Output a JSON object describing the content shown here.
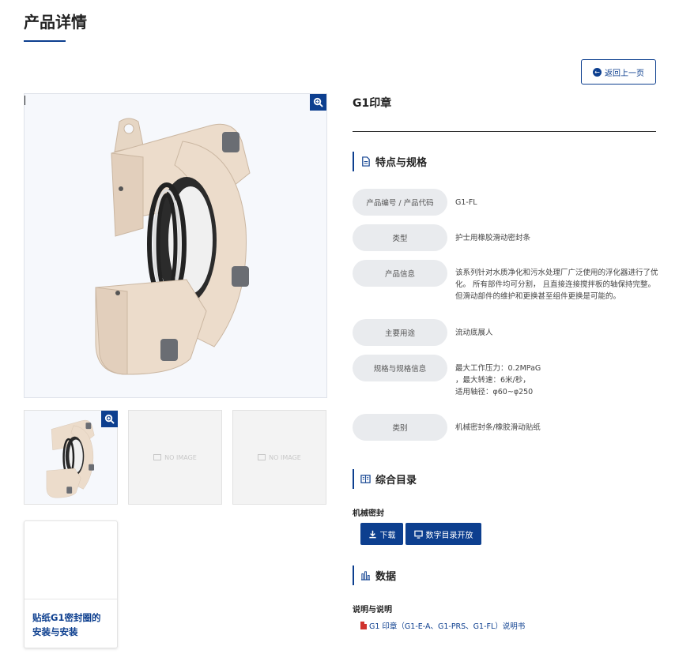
{
  "page": {
    "title": "产品详情"
  },
  "back_button": {
    "label": "返回上一页",
    "icon": "arrow-left-circle-icon"
  },
  "gallery": {
    "main_image_alt": "G1 seal product render",
    "zoom_icon": "zoom-in-icon",
    "no_image_label": "NO IMAGE"
  },
  "card": {
    "title": "贴纸G1密封圈的安装与安装"
  },
  "product": {
    "name": "G1印章"
  },
  "specs": {
    "heading": "特点与规格",
    "rows": [
      {
        "label": "产品编号 / 产品代码",
        "value": "G1-FL"
      },
      {
        "label": "类型",
        "value": "护士用橡胶滑动密封条"
      },
      {
        "label": "产品信息",
        "value": "该系列针对水质净化和污水处理厂广泛使用的浮化器进行了优化。 所有部件均可分割， 且直接连接搅拌板的轴保持完整。但滑动部件的维护和更换甚至组件更换是可能的。"
      },
      {
        "label": "主要用途",
        "value": "流动底展人"
      },
      {
        "label": "规格与规格信息",
        "value_lines": [
          "最大工作压力：0.2MPaG",
          "，最大转速：6米/秒，",
          "适用轴径：φ60~φ250"
        ]
      },
      {
        "label": "类别",
        "value": "机械密封条/橡胶滑动贴纸"
      }
    ]
  },
  "catalog": {
    "heading": "综合目录",
    "category": "机械密封",
    "download_label": "下载",
    "digital_label": "数字目录开放"
  },
  "data_section": {
    "heading": "数据",
    "sub_label": "说明与说明",
    "doc_link": "G1 印章（G1-E-A、G1-PRS、G1-FL）说明书"
  },
  "colors": {
    "accent": "#0d3f8f",
    "pill": "#e9ebee",
    "pdf": "#d0322d"
  }
}
